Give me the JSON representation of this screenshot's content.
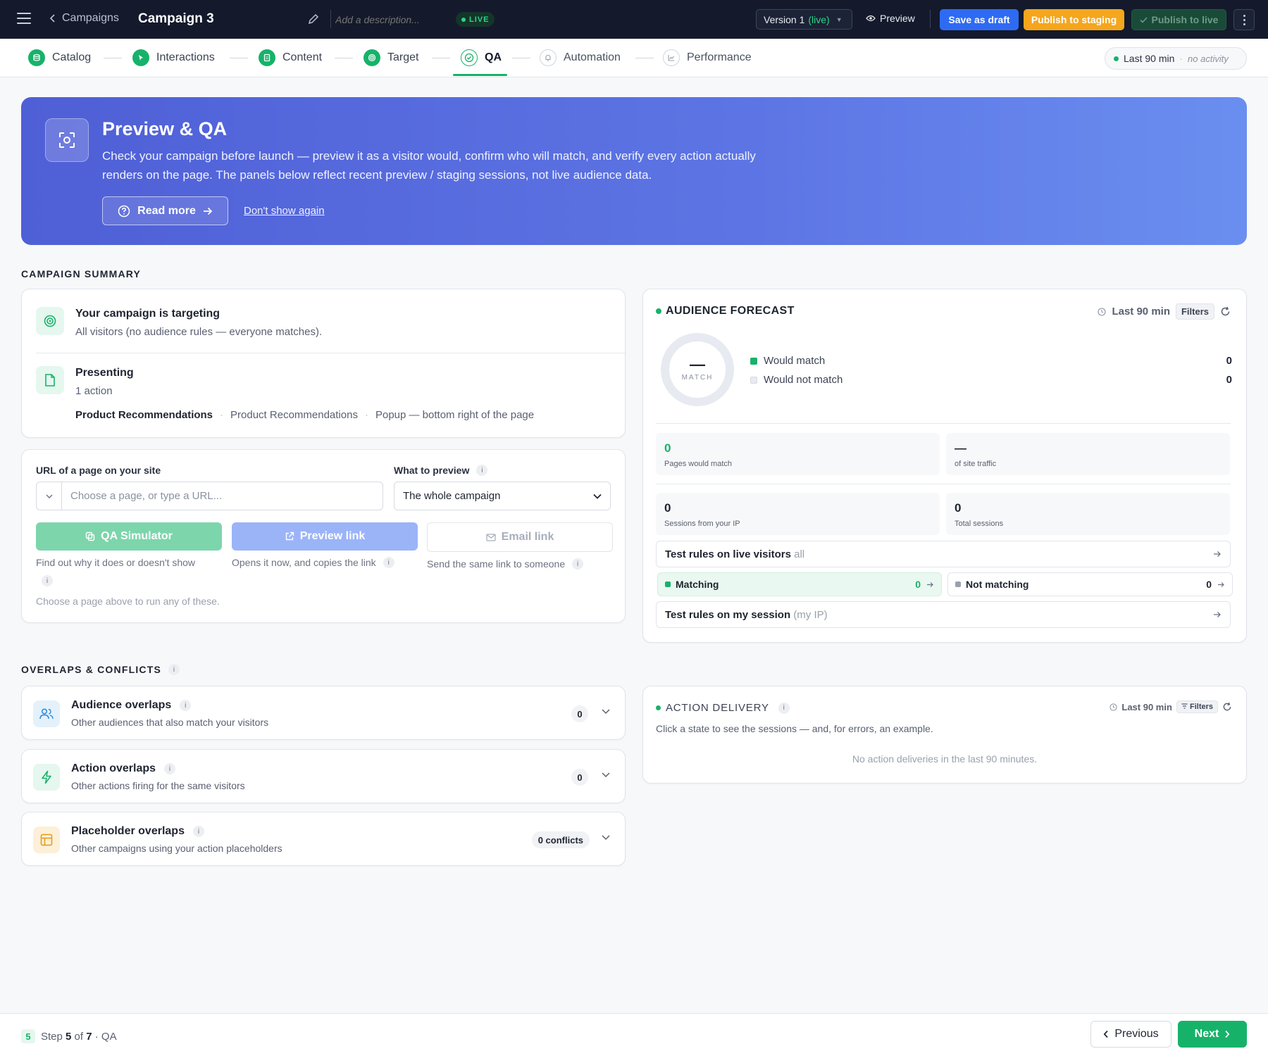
{
  "topbar": {
    "back_label": "Campaigns",
    "campaign_name": "Campaign 3",
    "description_placeholder": "Add a description...",
    "status_badge": "LIVE",
    "version_label": "Version 1",
    "version_status": "(live)",
    "preview_label": "Preview",
    "save_draft_label": "Save as draft",
    "publish_staging_label": "Publish to staging",
    "publish_live_label": "Publish to live",
    "icons": {
      "menu": "hamburger-icon",
      "edit": "pencil-icon",
      "preview": "eye-icon",
      "more": "kebab-icon"
    },
    "colors": {
      "save_draft": "#2e6bf2",
      "publish_staging": "#f5a61d",
      "live": "#2fd486"
    }
  },
  "steps": [
    {
      "label": "Catalog",
      "state": "done",
      "icon": "database-icon"
    },
    {
      "label": "Interactions",
      "state": "done",
      "icon": "cursor-icon"
    },
    {
      "label": "Content",
      "state": "done",
      "icon": "document-icon"
    },
    {
      "label": "Target",
      "state": "done",
      "icon": "target-icon"
    },
    {
      "label": "QA",
      "state": "active",
      "icon": "check-circle-icon"
    },
    {
      "label": "Automation",
      "state": "pending",
      "icon": "bell-icon"
    },
    {
      "label": "Performance",
      "state": "pending",
      "icon": "chart-icon"
    }
  ],
  "range_pill": {
    "label": "Last 90 min",
    "sep": "·",
    "status": "no activity"
  },
  "hero": {
    "title": "Preview & QA",
    "body": "Check your campaign before launch — preview it as a visitor would, confirm who will match, and verify every action actually renders on the page. The panels below reflect recent preview / staging sessions, not live audience data.",
    "read_more_label": "Read more",
    "dont_show_label": "Don't show again"
  },
  "campaign_summary": {
    "heading": "CAMPAIGN SUMMARY",
    "targeting_title": "Your campaign is targeting",
    "targeting_sub": "All visitors (no audience rules — everyone matches).",
    "presenting_title": "Presenting",
    "presenting_sub": "1 action",
    "tags": [
      "Product Recommendations",
      "Product Recommendations",
      "Popup — bottom right of the page"
    ],
    "tag_sep": "·"
  },
  "preview_panel": {
    "url_label": "URL of a page on your site",
    "url_placeholder": "Choose a page, or type a URL...",
    "url_value": "",
    "what_label": "What to preview",
    "what_value": "The whole campaign",
    "info_glyph": "i",
    "qa_label": "QA Simulator",
    "qa_desc": "Find out why it does or doesn't show",
    "preview_link_label": "Preview link",
    "preview_link_desc": "Opens it now, and copies the link",
    "email_label": "Email link",
    "email_desc": "Send the same link to someone",
    "hint": "Choose a page above to run any of these."
  },
  "audience_forecast": {
    "title": "AUDIENCE FORECAST",
    "range_label": "Last 90 min",
    "filters_label": "Filters",
    "donut_value": "—",
    "donut_label": "MATCH",
    "match_fraction": 0,
    "legend": [
      {
        "label": "Would match",
        "value": "0",
        "color": "#17b26a"
      },
      {
        "label": "Would not match",
        "value": "0",
        "color": "#e7eaf0"
      }
    ],
    "stats": [
      {
        "value": "0",
        "caption": "Pages would match"
      },
      {
        "value": "—",
        "caption": "of site traffic"
      },
      {
        "value": "0",
        "caption": "Sessions from your IP"
      },
      {
        "value": "0",
        "caption": "Total sessions"
      }
    ],
    "test_live": {
      "label": "Test rules on live visitors",
      "muted": "all"
    },
    "matching": {
      "label": "Matching",
      "value": "0"
    },
    "not_matching": {
      "label": "Not matching",
      "value": "0"
    },
    "test_session": {
      "label": "Test rules on my session",
      "muted": "(my IP)"
    }
  },
  "overlaps": {
    "heading": "OVERLAPS & CONFLICTS",
    "items": [
      {
        "title": "Audience overlaps",
        "sub": "Other audiences that also match your visitors",
        "count": "0",
        "icon": "users-icon"
      },
      {
        "title": "Action overlaps",
        "sub": "Other actions firing for the same visitors",
        "count": "0",
        "icon": "lightning-icon"
      },
      {
        "title": "Placeholder overlaps",
        "sub": "Other campaigns using your action placeholders",
        "count": "0 conflicts",
        "icon": "layout-icon"
      }
    ]
  },
  "action_delivery": {
    "title": "ACTION DELIVERY",
    "range_label": "Last 90 min",
    "filters_label": "Filters",
    "sub": "Click a state to see the sessions — and, for errors, an example.",
    "empty": "No action deliveries in the last 90 minutes."
  },
  "footer": {
    "step_number": "5",
    "step_word": "Step",
    "current": "5",
    "of_word": "of",
    "total": "7",
    "suffix": "· QA",
    "prev_label": "Previous",
    "next_label": "Next"
  }
}
